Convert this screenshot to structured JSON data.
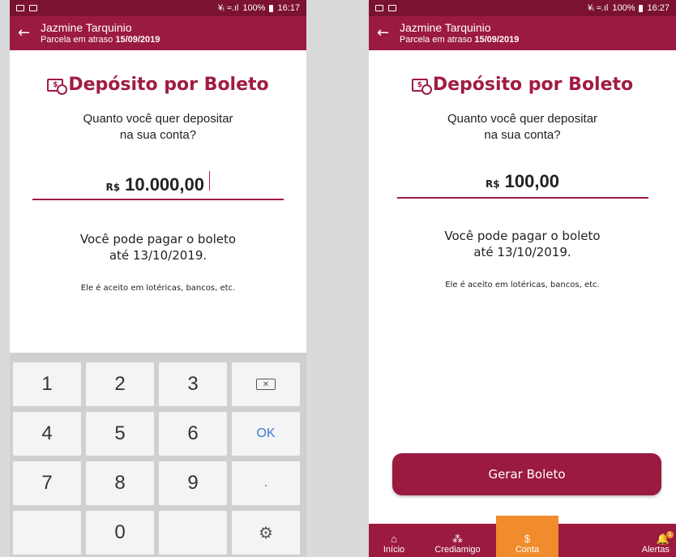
{
  "left": {
    "status": {
      "signal": "¥ᵢ ≈.ıl",
      "battery": "100%",
      "time": "16:17"
    },
    "header": {
      "name": "Jazmine Tarquinio",
      "subtitle": "Parcela em atraso",
      "date": "15/09/2019"
    },
    "title": "Depósito por Boleto",
    "question_line1": "Quanto você quer depositar",
    "question_line2": "na sua conta?",
    "currency": "R$",
    "amount": "10.000,00",
    "pay_line1": "Você pode pagar o boleto",
    "pay_line2": "até 13/10/2019.",
    "accepted": "Ele é aceito em lotéricas, bancos, etc.",
    "keypad": {
      "k1": "1",
      "k2": "2",
      "k3": "3",
      "k4": "4",
      "k5": "5",
      "k6": "6",
      "k7": "7",
      "k8": "8",
      "k9": "9",
      "k0": "0",
      "ok": "OK",
      "dot": "."
    }
  },
  "right": {
    "status": {
      "signal": "¥ᵢ ≈.ıl",
      "battery": "100%",
      "time": "16:27"
    },
    "header": {
      "name": "Jazmine Tarquinio",
      "subtitle": "Parcela em atraso",
      "date": "15/09/2019"
    },
    "title": "Depósito por Boleto",
    "question_line1": "Quanto você quer depositar",
    "question_line2": "na sua conta?",
    "currency": "R$",
    "amount": "100,00",
    "pay_line1": "Você pode pagar o boleto",
    "pay_line2": "até 13/10/2019.",
    "accepted": "Ele é aceito em lotéricas, bancos, etc.",
    "generate_button": "Gerar Boleto",
    "nav": {
      "home": "Início",
      "crediamigo": "Crediamigo",
      "conta": "Conta",
      "conta_icon": "$",
      "alertas": "Alertas",
      "alert_badge": "1"
    }
  },
  "colors": {
    "brand": "#9b1a3f",
    "accent": "#f08c2c",
    "ok_key": "#3b7ccf"
  }
}
